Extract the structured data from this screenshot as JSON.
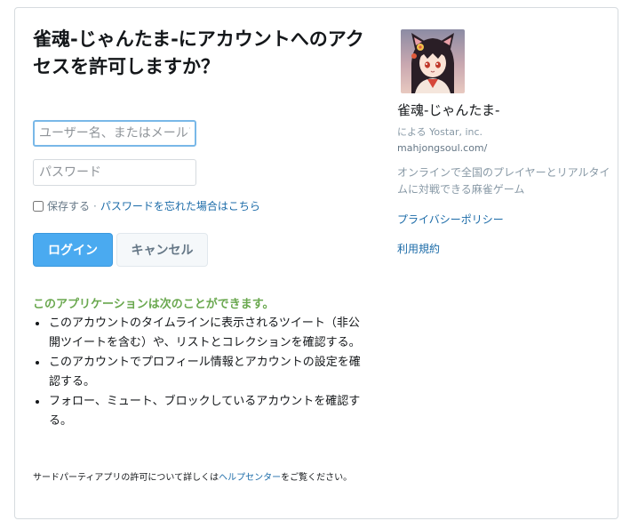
{
  "auth": {
    "title": "雀魂-じゃんたま-にアカウントへのアクセスを許可しますか？",
    "username_placeholder": "ユーザー名、またはメールアドレス",
    "password_placeholder": "パスワード",
    "remember_label": "保存する",
    "separator": "·",
    "forgot_password": "パスワードを忘れた場合はこちら",
    "login_label": "ログイン",
    "cancel_label": "キャンセル"
  },
  "permissions": {
    "heading": "このアプリケーションは次のことができます。",
    "items": [
      "このアカウントのタイムラインに表示されるツイート（非公開ツイートを含む）や、リストとコレクションを確認する。",
      "このアカウントでプロフィール情報とアカウントの設定を確認する。",
      "フォロー、ミュート、ブロックしているアカウントを確認する。"
    ]
  },
  "footer": {
    "text_before": "サードパーティアプリの許可について詳しくは",
    "link": "ヘルプセンター",
    "text_after": "をご覧ください。"
  },
  "app": {
    "name": "雀魂-じゃんたま-",
    "by": "による Yostar, inc.",
    "url": "mahjongsoul.com/",
    "description": "オンラインで全国のプレイヤーとリアルタイムに対戦できる麻雀ゲーム",
    "privacy_policy": "プライバシーポリシー",
    "terms": "利用規約"
  },
  "colors": {
    "primary_button": "#4aaaf0",
    "link": "#1b6ba8",
    "permission_heading": "#6aa84f"
  }
}
